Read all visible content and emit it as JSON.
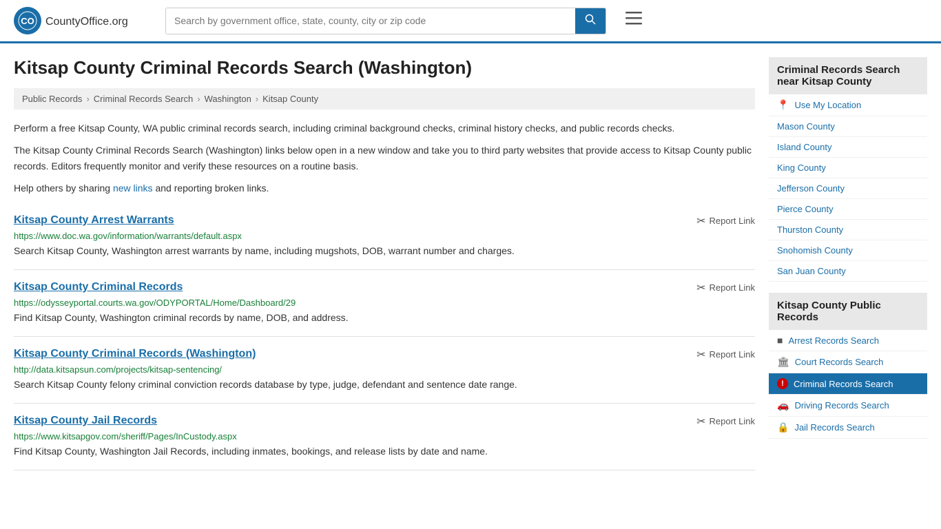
{
  "header": {
    "logo_text": "CountyOffice",
    "logo_suffix": ".org",
    "search_placeholder": "Search by government office, state, county, city or zip code",
    "search_value": ""
  },
  "page": {
    "title": "Kitsap County Criminal Records Search (Washington)",
    "breadcrumbs": [
      {
        "label": "Public Records",
        "href": "#"
      },
      {
        "label": "Criminal Records Search",
        "href": "#"
      },
      {
        "label": "Washington",
        "href": "#"
      },
      {
        "label": "Kitsap County",
        "href": "#"
      }
    ],
    "desc1": "Perform a free Kitsap County, WA public criminal records search, including criminal background checks, criminal history checks, and public records checks.",
    "desc2": "The Kitsap County Criminal Records Search (Washington) links below open in a new window and take you to third party websites that provide access to Kitsap County public records. Editors frequently monitor and verify these resources on a routine basis.",
    "desc3_pre": "Help others by sharing ",
    "desc3_link": "new links",
    "desc3_post": " and reporting broken links."
  },
  "results": [
    {
      "title": "Kitsap County Arrest Warrants",
      "url": "https://www.doc.wa.gov/information/warrants/default.aspx",
      "desc": "Search Kitsap County, Washington arrest warrants by name, including mugshots, DOB, warrant number and charges.",
      "report_label": "Report Link"
    },
    {
      "title": "Kitsap County Criminal Records",
      "url": "https://odysseyportal.courts.wa.gov/ODYPORTAL/Home/Dashboard/29",
      "desc": "Find Kitsap County, Washington criminal records by name, DOB, and address.",
      "report_label": "Report Link"
    },
    {
      "title": "Kitsap County Criminal Records (Washington)",
      "url": "http://data.kitsapsun.com/projects/kitsap-sentencing/",
      "desc": "Search Kitsap County felony criminal conviction records database by type, judge, defendant and sentence date range.",
      "report_label": "Report Link"
    },
    {
      "title": "Kitsap County Jail Records",
      "url": "https://www.kitsapgov.com/sheriff/Pages/InCustody.aspx",
      "desc": "Find Kitsap County, Washington Jail Records, including inmates, bookings, and release lists by date and name.",
      "report_label": "Report Link"
    }
  ],
  "sidebar": {
    "nearby_header": "Criminal Records Search near Kitsap County",
    "use_my_location": "Use My Location",
    "nearby_counties": [
      "Mason County",
      "Island County",
      "King County",
      "Jefferson County",
      "Pierce County",
      "Thurston County",
      "Snohomish County",
      "San Juan County"
    ],
    "public_records_header": "Kitsap County Public Records",
    "public_records_links": [
      {
        "label": "Arrest Records Search",
        "icon": "■",
        "active": false
      },
      {
        "label": "Court Records Search",
        "icon": "🏛",
        "active": false
      },
      {
        "label": "Criminal Records Search",
        "icon": "!",
        "active": true
      },
      {
        "label": "Driving Records Search",
        "icon": "🚗",
        "active": false
      },
      {
        "label": "Jail Records Search",
        "icon": "🔒",
        "active": false
      }
    ]
  }
}
